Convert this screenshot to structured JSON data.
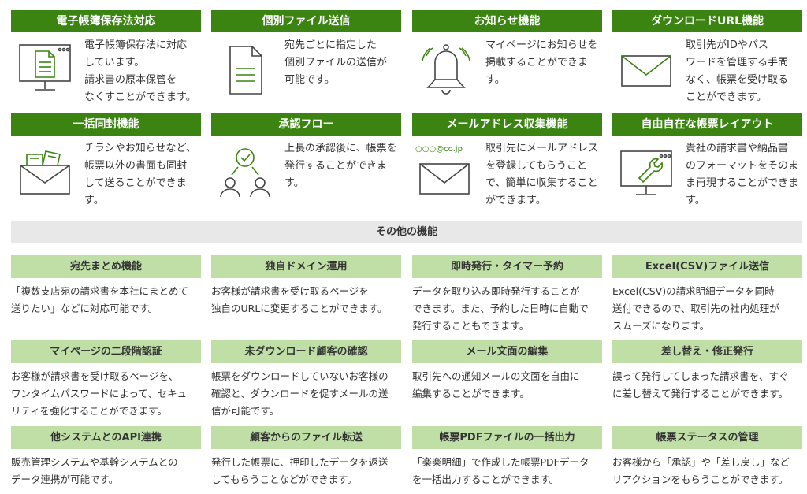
{
  "features": [
    {
      "title": "電子帳簿保存法対応",
      "icon": "monitor-document-icon",
      "desc": [
        "電子帳簿保存法に対応",
        "しています。",
        "請求書の原本保管を",
        "なくすことができます。"
      ]
    },
    {
      "title": "個別ファイル送信",
      "icon": "document-icon",
      "desc": [
        "宛先ごとに指定した",
        "個別ファイルの送信が",
        "可能です。"
      ]
    },
    {
      "title": "お知らせ機能",
      "icon": "bell-icon",
      "desc": [
        "マイページにお知らせを",
        "掲載することができま",
        "す。"
      ]
    },
    {
      "title": "ダウンロードURL機能",
      "icon": "envelope-icon",
      "desc": [
        "取引先がIDやパス",
        "ワードを管理する手間",
        "なく、帳票を受け取る",
        "ことができます。"
      ]
    },
    {
      "title": "一括同封機能",
      "icon": "envelope-with-papers-icon",
      "desc": [
        "チラシやお知らせなど、",
        "帳票以外の書面も同封",
        "して送ることができま",
        "す。"
      ]
    },
    {
      "title": "承認フロー",
      "icon": "approval-flow-icon",
      "desc": [
        "上長の承認後に、帳票を",
        "発行することができま",
        "す。"
      ]
    },
    {
      "title": "メールアドレス収集機能",
      "icon": "email-collect-icon",
      "icon_text": "○○○@co.jp",
      "desc": [
        "取引先にメールアドレス",
        "を登録してもらうこと",
        "で、簡単に収集すること",
        "ができます。"
      ]
    },
    {
      "title": "自由自在な帳票レイアウト",
      "icon": "monitor-wrench-icon",
      "desc": [
        "貴社の請求書や納品書",
        "のフォーマットをそのま",
        "ま再現することができま",
        "す。"
      ]
    }
  ],
  "other_heading": "その他の機能",
  "options": [
    {
      "title": "宛先まとめ機能",
      "desc": [
        "「複数支店宛の請求書を本社にまとめて",
        "送りたい」などに対応可能です。"
      ]
    },
    {
      "title": "独自ドメイン運用",
      "desc": [
        "お客様が請求書を受け取るページを",
        "独自のURLに変更することができます。"
      ]
    },
    {
      "title": "即時発行・タイマー予約",
      "desc": [
        "データを取り込み即時発行することが",
        "できます。また、予約した日時に自動で",
        "発行することもできます。"
      ]
    },
    {
      "title": "Excel(CSV)ファイル送信",
      "desc": [
        "Excel(CSV)の請求明細データを同時",
        "送付できるので、取引先の社内処理が",
        "スムーズになります。"
      ]
    },
    {
      "title": "マイページの二段階認証",
      "desc": [
        "お客様が請求書を受け取るページを、",
        "ワンタイムパスワードによって、セキュ",
        "リティを強化することができます。"
      ]
    },
    {
      "title": "未ダウンロード顧客の確認",
      "desc": [
        "帳票をダウンロードしていないお客様の",
        "確認と、ダウンロードを促すメールの送",
        "信が可能です。"
      ]
    },
    {
      "title": "メール文面の編集",
      "desc": [
        "取引先への通知メールの文面を自由に",
        "編集することができます。"
      ]
    },
    {
      "title": "差し替え・修正発行",
      "desc": [
        "誤って発行してしまった請求書を、すぐ",
        "に差し替えて発行することができます。"
      ]
    },
    {
      "title": "他システムとのAPI連携",
      "desc": [
        "販売管理システムや基幹システムとの",
        "データ連携が可能です。"
      ]
    },
    {
      "title": "顧客からのファイル転送",
      "desc": [
        "発行した帳票に、押印したデータを返送",
        "してもらうことなどができます。"
      ]
    },
    {
      "title": "帳票PDFファイルの一括出力",
      "desc": [
        "「楽楽明細」で作成した帳票PDFデータ",
        "を一括出力することができます。"
      ]
    },
    {
      "title": "帳票ステータスの管理",
      "desc": [
        "お客様から「承認」や「差し戻し」など",
        "リアクションをもらうことができます。"
      ]
    }
  ],
  "colors": {
    "primary_green": "#3b8412",
    "light_green": "#bfdfa6",
    "gray_bar": "#e8e8e8",
    "icon_stroke": "#444444",
    "icon_accent": "#3b8412"
  }
}
